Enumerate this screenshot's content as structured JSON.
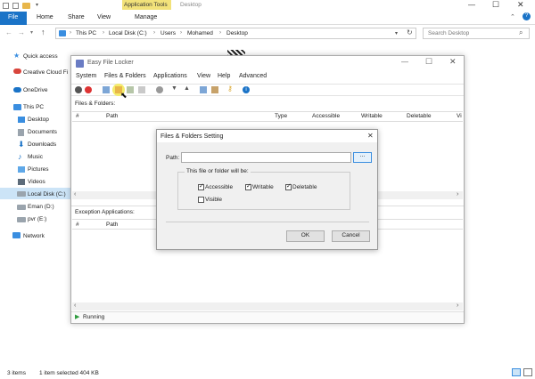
{
  "explorer": {
    "ribbon": {
      "context_tab": "Application Tools",
      "path_title": "Desktop",
      "tabs": [
        "File",
        "Home",
        "Share",
        "View",
        "Manage"
      ]
    },
    "address": {
      "crumbs": [
        "This PC",
        "Local Disk (C:)",
        "Users",
        "Mohamed",
        "Desktop"
      ],
      "search_placeholder": "Search Desktop"
    },
    "sidebar": {
      "items": [
        {
          "label": "Quick access",
          "icon": "star-icon"
        },
        {
          "label": "Creative Cloud Fi",
          "icon": "cloud-icon"
        },
        {
          "label": "OneDrive",
          "icon": "cloud-icon"
        },
        {
          "label": "This PC",
          "icon": "computer-icon"
        },
        {
          "label": "Desktop",
          "icon": "folder-icon"
        },
        {
          "label": "Documents",
          "icon": "folder-icon"
        },
        {
          "label": "Downloads",
          "icon": "download-icon"
        },
        {
          "label": "Music",
          "icon": "music-icon"
        },
        {
          "label": "Pictures",
          "icon": "folder-icon"
        },
        {
          "label": "Videos",
          "icon": "folder-icon"
        },
        {
          "label": "Local Disk (C:)",
          "icon": "drive-icon"
        },
        {
          "label": "Eman (D:)",
          "icon": "drive-icon"
        },
        {
          "label": "pvr (E:)",
          "icon": "drive-icon"
        },
        {
          "label": "Network",
          "icon": "network-icon"
        }
      ]
    },
    "status": {
      "items": "3 items",
      "selected": "1 item selected  404 KB"
    }
  },
  "app": {
    "title": "Easy File Locker",
    "menu": [
      "System",
      "Files & Folders",
      "Applications",
      "View",
      "Help",
      "Advanced"
    ],
    "files_label": "Files & Folders:",
    "columns": [
      "#",
      "Path",
      "Type",
      "Accessible",
      "Writable",
      "Deletable",
      "Vi"
    ],
    "exceptions_label": "Exception Applications:",
    "exception_columns": [
      "#",
      "Path"
    ],
    "status": "Running"
  },
  "dialog": {
    "title": "Files & Folders Setting",
    "path_label": "Path:",
    "path_value": "",
    "browse_label": "...",
    "group_label": "This file or folder will be:",
    "options": [
      {
        "label": "Accessible",
        "checked": true
      },
      {
        "label": "Writable",
        "checked": true
      },
      {
        "label": "Deletable",
        "checked": true
      },
      {
        "label": "Visible",
        "checked": false
      }
    ],
    "ok_label": "OK",
    "cancel_label": "Cancel",
    "close_label": "✕"
  },
  "colors": {
    "accent": "#1a73c7",
    "context_tab": "#f2e27a",
    "running": "#2e9b3e"
  }
}
